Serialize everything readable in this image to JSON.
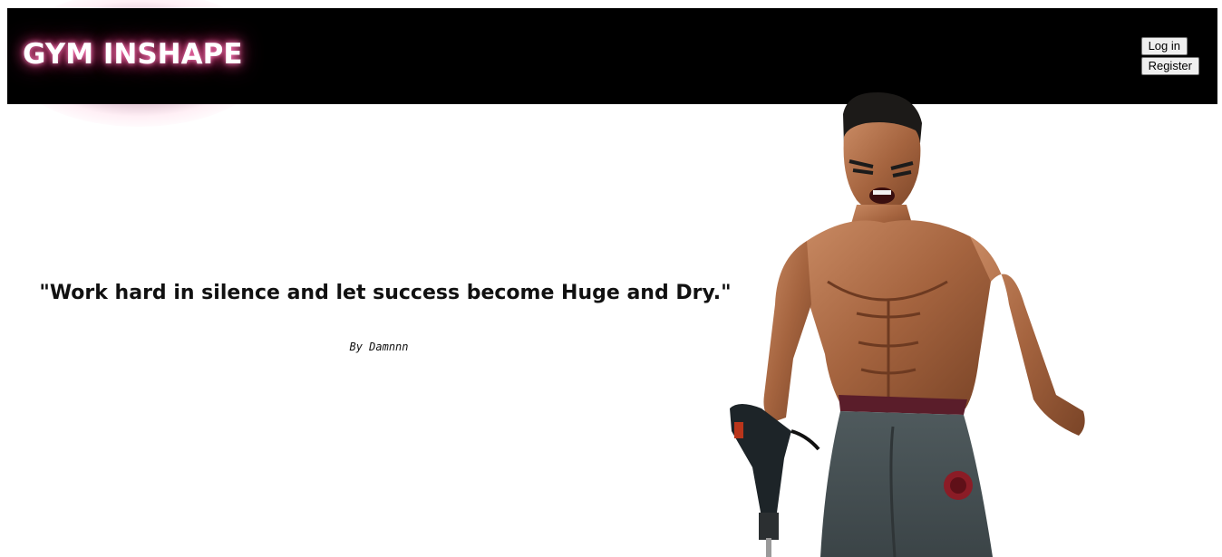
{
  "header": {
    "logo_text": "GYM INSHAPE",
    "login_label": "Log in",
    "register_label": "Register"
  },
  "hero": {
    "quote": "\"Work hard in silence and let success become Huge and Dry.\"",
    "author": "By Damnnn"
  },
  "colors": {
    "header_bg": "#000000",
    "logo_glow": "#e0407a",
    "page_bg": "#ffffff"
  }
}
